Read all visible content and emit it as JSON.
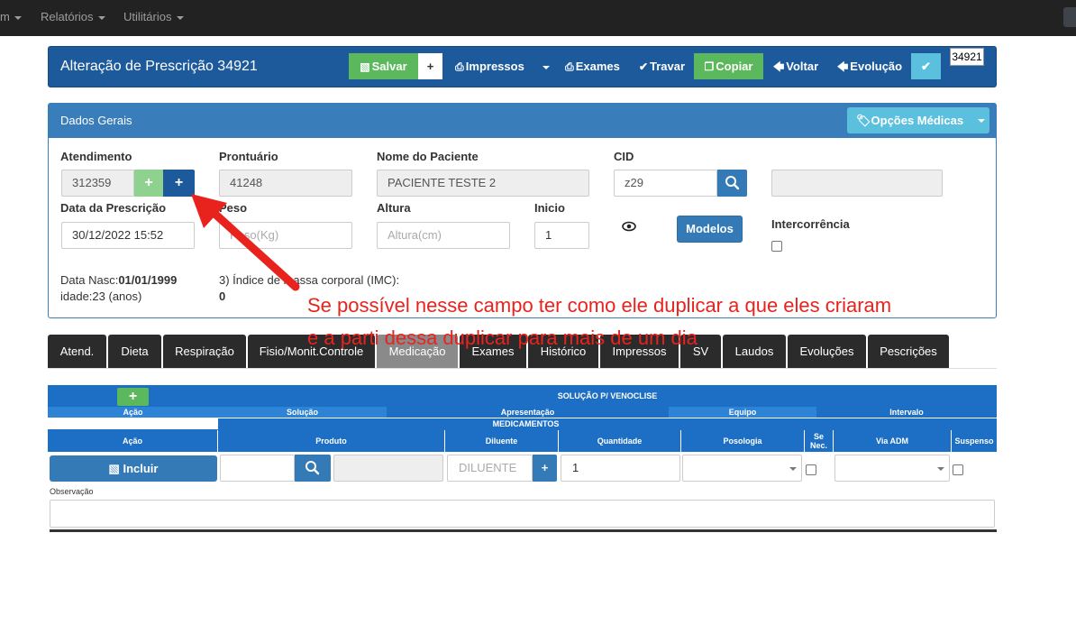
{
  "topnav": {
    "items": [
      "m",
      "Relatórios",
      "Utilitários"
    ]
  },
  "header": {
    "title": "Alteração de Prescrição 34921",
    "buttons": {
      "salvar": "Salvar",
      "plus": "+",
      "impressos": "Impressos",
      "exames": "Exames",
      "travar": "Travar",
      "copiar": "Copiar",
      "voltar": "Voltar",
      "evolucao": "Evolução"
    },
    "badge": "34921"
  },
  "panel": {
    "title": "Dados Gerais",
    "opcoes": "Opções Médicas",
    "atendimento": {
      "label": "Atendimento",
      "value": "312359"
    },
    "prontuario": {
      "label": "Prontuário",
      "value": "41248"
    },
    "paciente": {
      "label": "Nome do Paciente",
      "value": "PACIENTE TESTE 2"
    },
    "cid": {
      "label": "CID",
      "value": "z29"
    },
    "data_prescricao": {
      "label": "Data da Prescrição",
      "value": "30/12/2022 15:52"
    },
    "peso": {
      "label": "Peso",
      "placeholder": "Peso(Kg)"
    },
    "altura": {
      "label": "Altura",
      "placeholder": "Altura(cm)"
    },
    "inicio": {
      "label": "Inicio",
      "value": "1"
    },
    "modelos": "Modelos",
    "intercorrencia": "Intercorrência",
    "data_nasc_label": "Data Nasc:",
    "data_nasc_value": "01/01/1999",
    "idade": "idade:23 (anos)",
    "imc_label": "3) Índice de massa corporal (IMC):",
    "imc_value": "0"
  },
  "annotation": {
    "line1": "Se possível nesse campo ter como ele duplicar a que eles criaram",
    "line2": "e a parti dessa duplicar para mais de um dia"
  },
  "tabs": [
    "Atend.",
    "Dieta",
    "Respiração",
    "Fisio/Monit.Controle",
    "Medicação",
    "Exames",
    "Histórico",
    "Impressos",
    "SV",
    "Laudos",
    "Evoluções",
    "Pescrições"
  ],
  "active_tab": "Medicação",
  "grid": {
    "acao": "Ação",
    "solucao_venoclise": "SOLUÇÃO P/ VENOCLISE",
    "solucao": "Solução",
    "apresentacao": "Apresentação",
    "equipo": "Equipo",
    "intervalo": "Intervalo",
    "medicamentos": "MEDICAMENTOS",
    "cols": {
      "acao": "Ação",
      "produto": "Produto",
      "diluente": "Diluente",
      "quantidade": "Quantidade",
      "posologia": "Posologia",
      "se_nec_1": "Se",
      "se_nec_2": "Nec.",
      "via_adm": "Via ADM",
      "suspenso": "Suspenso"
    },
    "incluir": "Incluir",
    "diluente_placeholder": "DILUENTE",
    "quantidade_value": "1",
    "observacao": "Observação"
  },
  "colors": {
    "navbar": "#222222",
    "header": "#1d5a9c",
    "panel_head": "#3a7dbb",
    "success": "#5cb85c",
    "info": "#5bc0de",
    "primary": "#337ab7",
    "annotation": "#e8231e"
  },
  "icons": [
    "save-icon",
    "print-icon",
    "check-icon",
    "copy-icon",
    "arrow-left-icon",
    "tag-icon",
    "search-icon",
    "eye-icon",
    "plus-icon",
    "arrow-pointer"
  ]
}
